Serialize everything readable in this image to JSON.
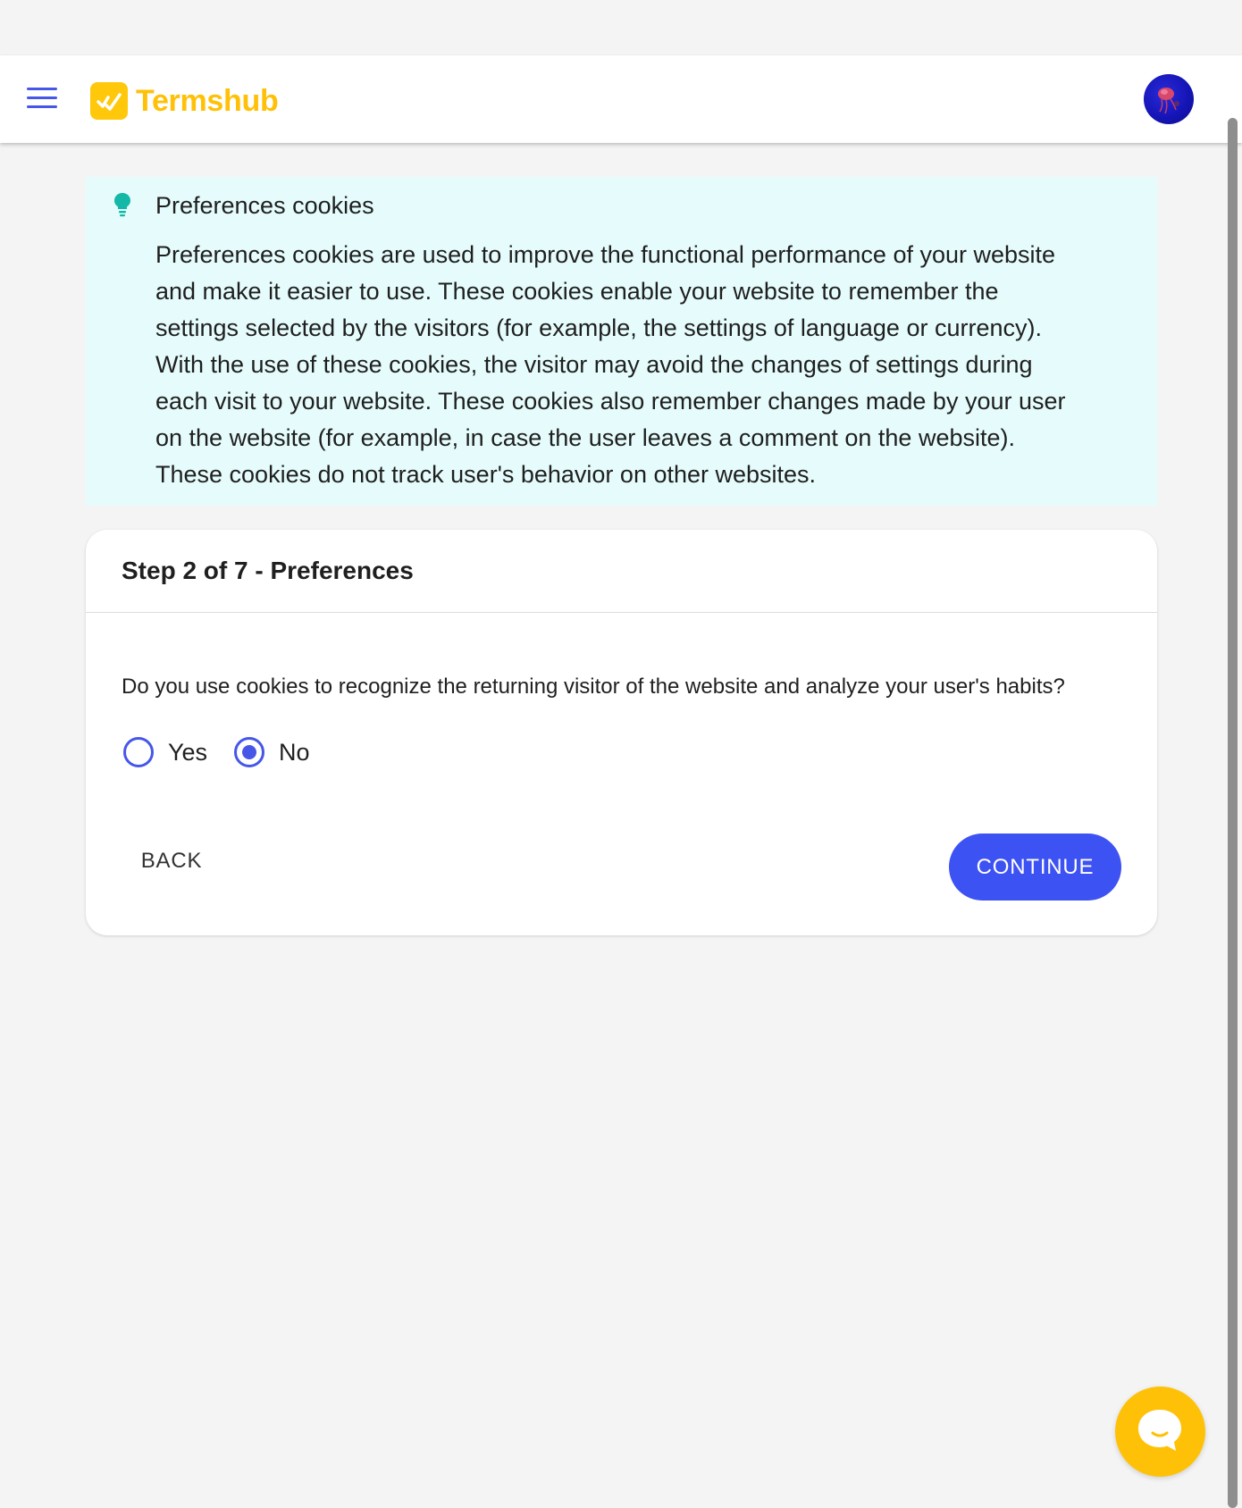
{
  "header": {
    "brand_name": "Termshub",
    "logo_icon": "check-mark-badge-icon",
    "menu_icon": "hamburger-menu-icon",
    "avatar_icon": "user-avatar-icon"
  },
  "info_box": {
    "icon": "lightbulb-icon",
    "title": "Preferences cookies",
    "lines": [
      "Preferences cookies are used to improve the functional performance of your website",
      "and make it easier to use. These cookies enable your website to remember the",
      "settings selected by the visitors (for example, the settings of language or currency).",
      "With the use of these cookies, the visitor may avoid the changes of settings during",
      "each visit to your website. These cookies also remember changes made by your user",
      "on the website (for example, in case the user leaves a comment on the website).",
      "These cookies do not track user's behavior on other websites."
    ]
  },
  "step_card": {
    "title": "Step 2 of 7 - Preferences",
    "question": "Do you use cookies to recognize the returning visitor of the website and analyze your user's habits?",
    "options": [
      {
        "label": "Yes",
        "selected": false
      },
      {
        "label": "No",
        "selected": true
      }
    ],
    "back_label": "BACK",
    "continue_label": "CONTINUE"
  },
  "chat": {
    "icon": "chat-bubble-icon"
  },
  "colors": {
    "accent": "#3d52f2",
    "brand": "#ffc107",
    "info_bg": "#e6fcfc",
    "info_icon": "#14b8a6"
  }
}
